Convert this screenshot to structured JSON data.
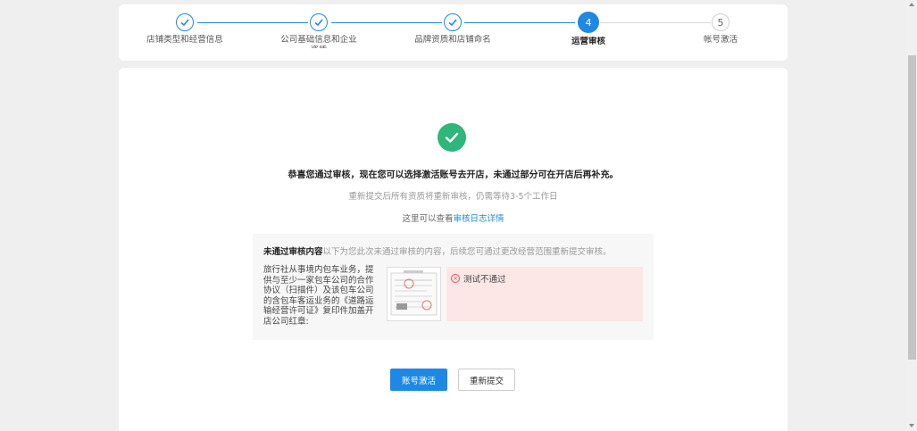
{
  "steps": [
    {
      "label": "店铺类型和经营信息",
      "status": "done"
    },
    {
      "label": "公司基础信息和企业资质",
      "status": "done"
    },
    {
      "label": "品牌资质和店铺命名",
      "status": "done"
    },
    {
      "label": "运营审核",
      "number": "4",
      "status": "active"
    },
    {
      "label": "帐号激活",
      "number": "5",
      "status": "todo"
    }
  ],
  "result": {
    "title": "恭喜您通过审核，现在您可以选择激活账号去开店，未通过部分可在开店后再补充。",
    "resubmit_note": "重新提交后所有资质将重新审核，仍需等待3-5个工作日",
    "log_prefix": "这里可以查看",
    "log_link": "审核日志详情"
  },
  "rejected": {
    "heading": "未通过审核内容",
    "heading_desc": "以下为您此次未通过审核的内容，后续您可通过更改经营范围重新提交审核。",
    "item_text": "旅行社从事境内包车业务，提供与至少一家包车公司的合作协议（扫描件）及该包车公司的含包车客运业务的《道路运输经营许可证》复印件加盖开店公司红章:",
    "result_text": "测试不通过"
  },
  "buttons": {
    "activate": "账号激活",
    "resubmit": "重新提交"
  },
  "colors": {
    "primary": "#1e88e5",
    "success": "#2fb67a",
    "error": "#e45656",
    "error_bg": "#fde6e6"
  }
}
